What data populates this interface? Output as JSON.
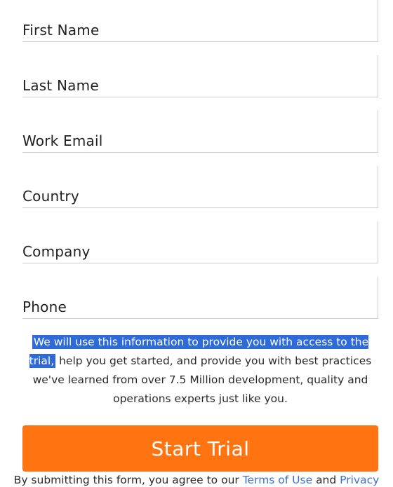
{
  "form": {
    "fields": [
      {
        "label": "First Name"
      },
      {
        "label": "Last Name"
      },
      {
        "label": "Work Email"
      },
      {
        "label": "Country"
      },
      {
        "label": "Company"
      },
      {
        "label": "Phone"
      }
    ]
  },
  "notice": {
    "highlighted": "We will use this information to provide you with access to the trial,",
    "rest": "help you get started, and provide you with best practices we've learned from over 7.5 Million development, quality and operations experts just like you."
  },
  "cta": {
    "label": "Start Trial",
    "color": "#ff7410"
  },
  "legal": {
    "prefix": "By submitting this form, you agree to our",
    "terms_link": "Terms of Use",
    "conjunction": "and",
    "privacy_link": "Privacy"
  },
  "colors": {
    "highlight": "#2f6bd8",
    "link": "#3a73c9"
  }
}
